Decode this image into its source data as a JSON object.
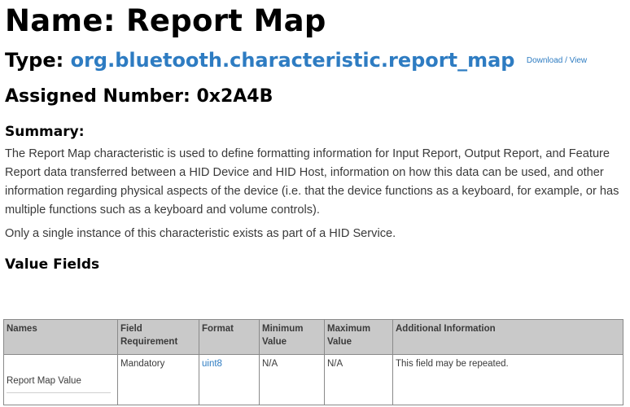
{
  "page": {
    "name_heading": "Name: Report Map",
    "type_label": "Type: ",
    "type_value": "org.bluetooth.characteristic.report_map",
    "download_link": "Download / View",
    "assigned_number": "Assigned Number: 0x2A4B",
    "summary_heading": "Summary:",
    "summary_paragraph": "The Report Map characteristic is used to define formatting information for Input Report, Output Report, and Feature Report data transferred between a HID Device and HID Host, information on how this data can be used, and other information regarding physical aspects of the device (i.e. that the device functions as a keyboard, for example, or has multiple functions such as a keyboard and volume controls).",
    "summary_paragraph_2": "Only a single instance of this characteristic exists as part of a HID Service.",
    "value_fields_heading": "Value Fields"
  },
  "table": {
    "headers": {
      "names": "Names",
      "field_requirement": "Field Requirement",
      "format": "Format",
      "minimum_value": "Minimum Value",
      "maximum_value": "Maximum Value",
      "additional_information": "Additional Information"
    },
    "rows": [
      {
        "name": "Report Map Value",
        "requirement": "Mandatory",
        "format": "uint8",
        "minimum": "N/A",
        "maximum": "N/A",
        "info": "This field may be repeated."
      }
    ]
  },
  "colors": {
    "link": "#2e7cc2",
    "table_header_bg": "#c9c9c9",
    "body_text": "#3a3a3a"
  }
}
